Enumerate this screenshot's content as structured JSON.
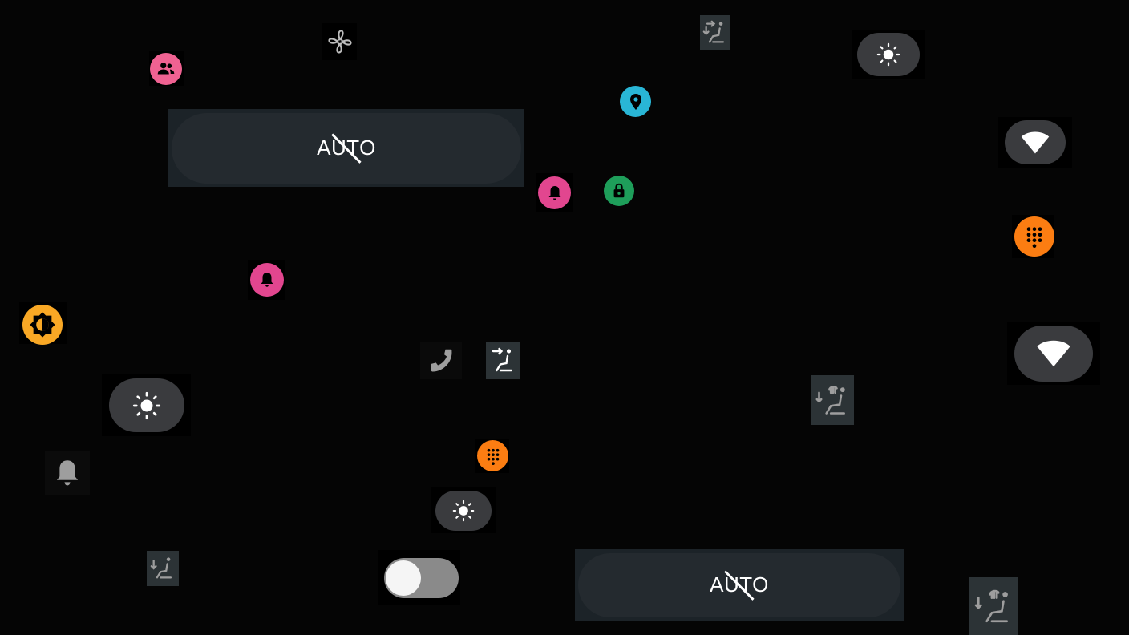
{
  "auto_buttons": {
    "top_label": "AUTO",
    "bottom_label": "AUTO"
  },
  "icons": {
    "fan": "fan-icon",
    "people": "people-icon",
    "seat_heat_top": "seat-heat-icon",
    "brightness": "brightness-icon",
    "location": "location-pin-icon",
    "wifi": "wifi-icon",
    "bell": "bell-icon",
    "lock": "lock-icon",
    "dialpad": "dialpad-icon",
    "brightness_auto": "brightness-auto-icon",
    "phone": "phone-icon",
    "seat_recline": "seat-recline-icon",
    "seat_warmer": "seat-warmer-icon",
    "toggle": "toggle-switch"
  },
  "colors": {
    "pink": "#f06292",
    "magenta": "#e2468f",
    "teal": "#29b6d6",
    "green": "#1e9e5a",
    "orange": "#fb7d12",
    "amber": "#f9a825",
    "pill_gray": "#3a3b3e",
    "seat_tile": "#2c3336",
    "auto_bg": "#1c2328"
  },
  "toggle": {
    "state": "off"
  }
}
